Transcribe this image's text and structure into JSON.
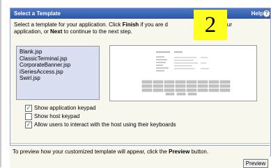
{
  "title": "Select a Template",
  "help": "Help",
  "instructions": {
    "pre_finish": "Select a template for your application. Click ",
    "finish": "Finish",
    "post_finish": " if you are d",
    "badge_tail": "guring your",
    "line2_pre": "application, or ",
    "next": "Next",
    "line2_post": " to continue to the next step."
  },
  "step_badge": "2",
  "templates": [
    "Blank.jsp",
    "ClassicTerminal.jsp",
    "CorporateBanner.jsp",
    "iSeriesAccess.jsp",
    "Swirl.jsp"
  ],
  "selected_template": "Blank.jsp",
  "options": [
    {
      "label": "Show application keypad",
      "checked": true
    },
    {
      "label": "Show host keypad",
      "checked": false
    },
    {
      "label": "Allow users to interact with the host using their keyboards",
      "checked": true
    }
  ],
  "preview_note": {
    "pre": "To preview how your customized template will appear, click the ",
    "bold": "Preview",
    "post": " button."
  },
  "preview_button": "Preview",
  "colors": {
    "titlebar": "#2c57a8",
    "list_background": "#d9dff0",
    "badge": "#ffff20",
    "panel": "#f7f7ee"
  }
}
